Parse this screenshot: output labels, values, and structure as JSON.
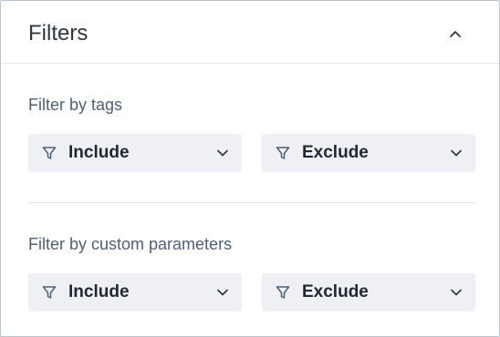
{
  "header": {
    "title": "Filters",
    "collapse_icon": "chevron-up-icon"
  },
  "sections": [
    {
      "label": "Filter by tags",
      "include": {
        "label": "Include",
        "icon": "filter-icon"
      },
      "exclude": {
        "label": "Exclude",
        "icon": "filter-icon"
      }
    },
    {
      "label": "Filter by custom parameters",
      "include": {
        "label": "Include",
        "icon": "filter-icon"
      },
      "exclude": {
        "label": "Exclude",
        "icon": "filter-icon"
      }
    }
  ],
  "colors": {
    "border": "#b7c6d4",
    "dropdown_bg": "#eef0f4",
    "label_text": "#4e6078",
    "title_text": "#2e3742"
  }
}
